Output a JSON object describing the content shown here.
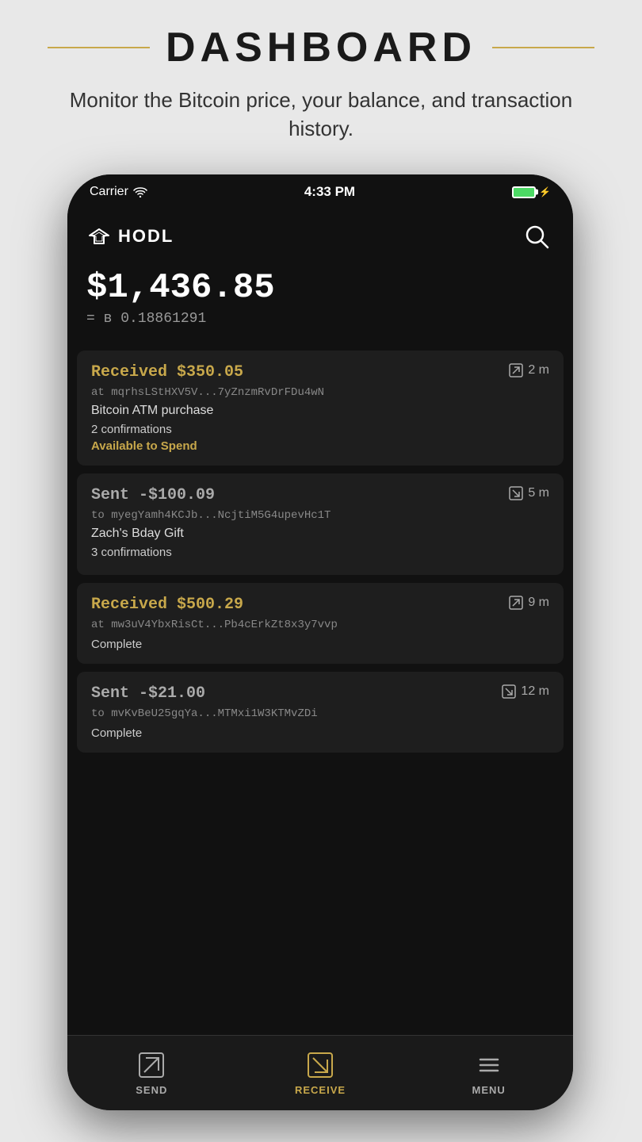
{
  "header": {
    "title": "DASHBOARD",
    "subtitle": "Monitor the Bitcoin price, your balance, and transaction history."
  },
  "statusBar": {
    "carrier": "Carrier",
    "time": "4:33 PM",
    "battery": "charging"
  },
  "app": {
    "logo": "◇HODL",
    "balance_usd": "$1,436.85",
    "balance_eq": "=",
    "balance_btc": "ʙ 0.18861291"
  },
  "transactions": [
    {
      "type": "received",
      "amount": "Received $350.05",
      "address": "at mqrhsLStHXV5V...7yZnzmRvDrFDu4wN",
      "label": "Bitcoin ATM purchase",
      "confirmations": "2 confirmations",
      "status": "Available to Spend",
      "time": "2 m",
      "time_type": "incoming"
    },
    {
      "type": "sent",
      "amount": "Sent -$100.09",
      "address": "to myegYamh4KCJb...NcjtiM5G4upevHc1T",
      "label": "Zach's Bday Gift",
      "confirmations": "3 confirmations",
      "status": "",
      "time": "5 m",
      "time_type": "outgoing"
    },
    {
      "type": "received",
      "amount": "Received $500.29",
      "address": "at mw3uV4YbxRisCt...Pb4cErkZt8x3y7vvp",
      "label": "",
      "confirmations": "",
      "status": "Complete",
      "time": "9 m",
      "time_type": "incoming"
    },
    {
      "type": "sent",
      "amount": "Sent -$21.00",
      "address": "to mvKvBeU25gqYa...MTMxi1W3KTMvZDi",
      "label": "",
      "confirmations": "",
      "status": "Complete",
      "time": "12 m",
      "time_type": "outgoing"
    }
  ],
  "nav": {
    "send_label": "SEND",
    "receive_label": "RECEIVE",
    "menu_label": "MENU"
  }
}
